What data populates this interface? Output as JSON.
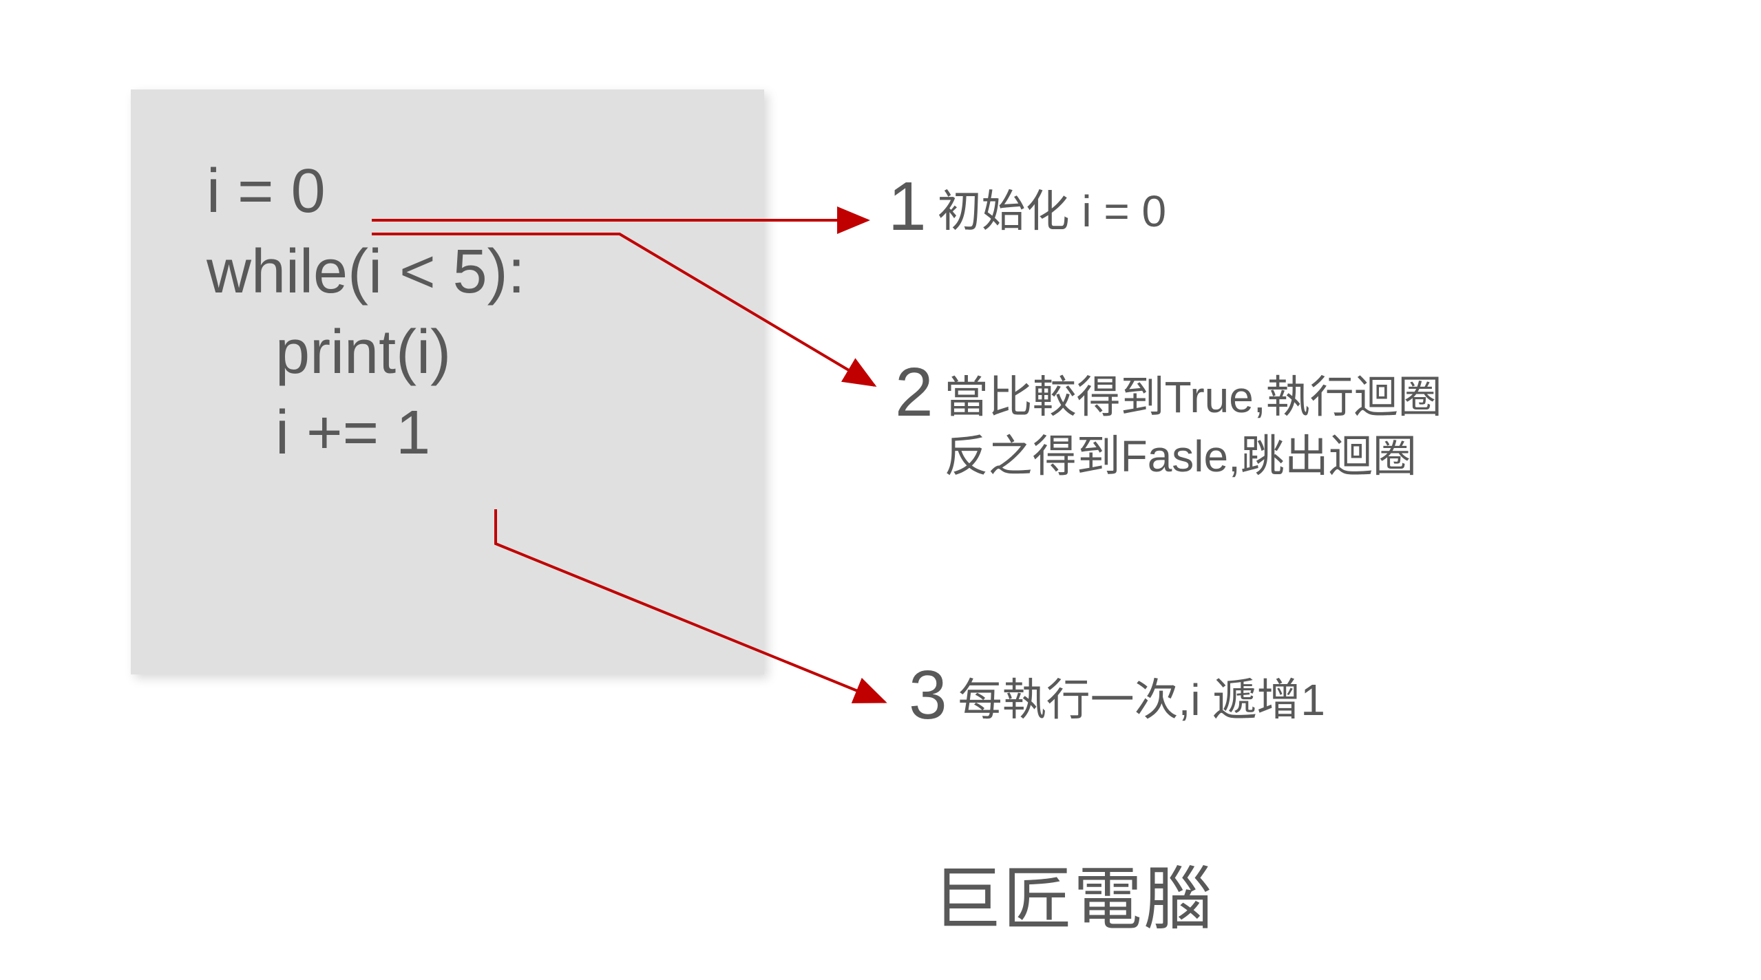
{
  "code": {
    "line1": "i = 0",
    "line2": "while(i < 5):",
    "line3": "    print(i)",
    "line4": "    i += 1"
  },
  "annotations": {
    "a1": {
      "num": "1",
      "text": "初始化 i = 0"
    },
    "a2": {
      "num": "2",
      "text": "當比較得到True,執行迴圈\n反之得到Fasle,跳出迴圈"
    },
    "a3": {
      "num": "3",
      "text": "每執行一次,i 遞增1"
    }
  },
  "watermark": "巨匠電腦",
  "colors": {
    "arrow": "#C00000",
    "textGray": "#595959",
    "codeBg": "#e0e0e0"
  }
}
